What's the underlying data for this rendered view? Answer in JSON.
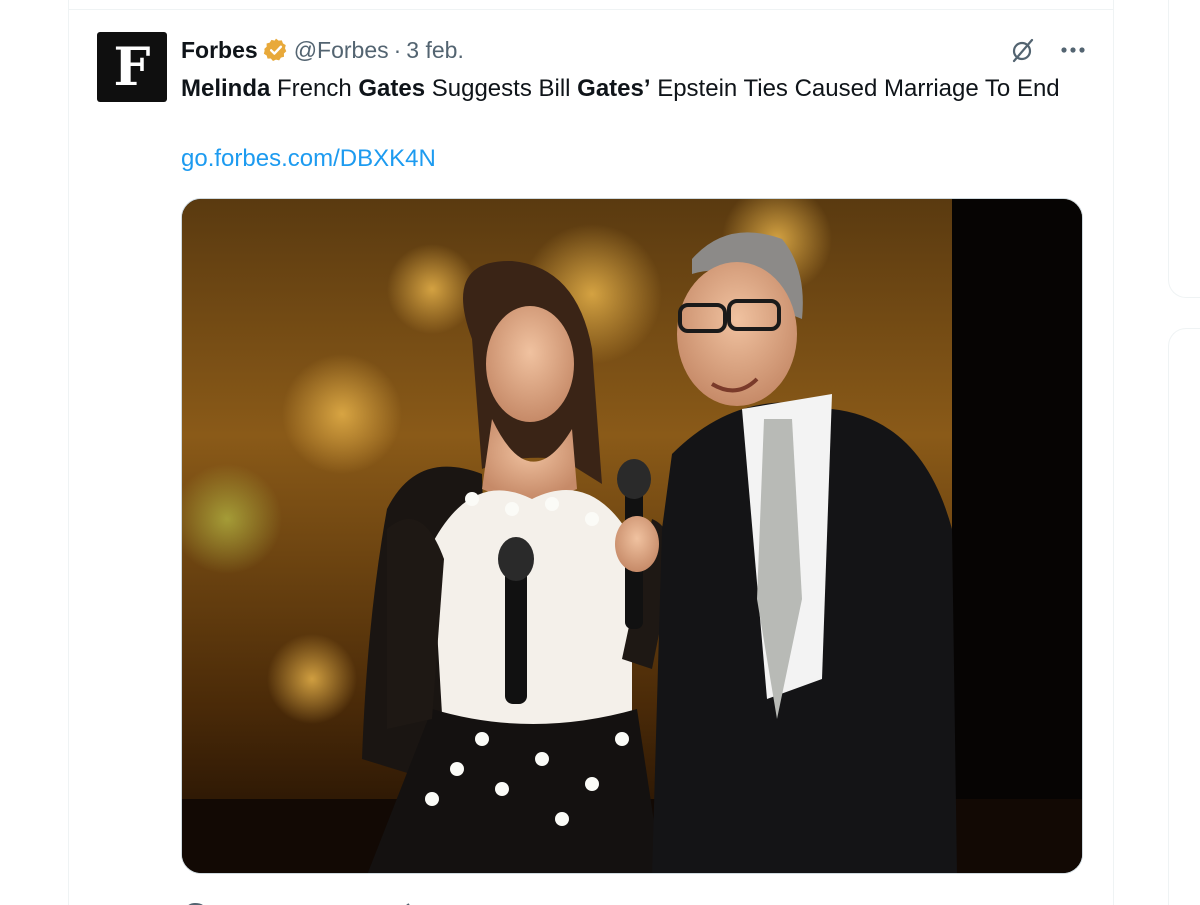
{
  "tweet": {
    "author_name": "Forbes",
    "handle": "@Forbes",
    "separator": "·",
    "date": "3 feb.",
    "avatar_letter": "F",
    "text_parts": [
      {
        "t": "Melinda",
        "b": true
      },
      {
        "t": " French ",
        "b": false
      },
      {
        "t": "Gates",
        "b": true
      },
      {
        "t": " Suggests Bill ",
        "b": false
      },
      {
        "t": "Gates’",
        "b": true
      },
      {
        "t": " Epstein Ties Caused Marriage To End",
        "b": false
      }
    ],
    "link": "go.forbes.com/DBXK4N"
  },
  "colors": {
    "link": "#1d9bf0",
    "verified_gold": "#e8a93a",
    "secondary_text": "#536471",
    "avatar_bg": "#0f0f0f"
  },
  "icons": {
    "verified": "verified-gold-badge-icon",
    "grok": "slashed-circle-icon",
    "more": "more-dots-icon"
  }
}
